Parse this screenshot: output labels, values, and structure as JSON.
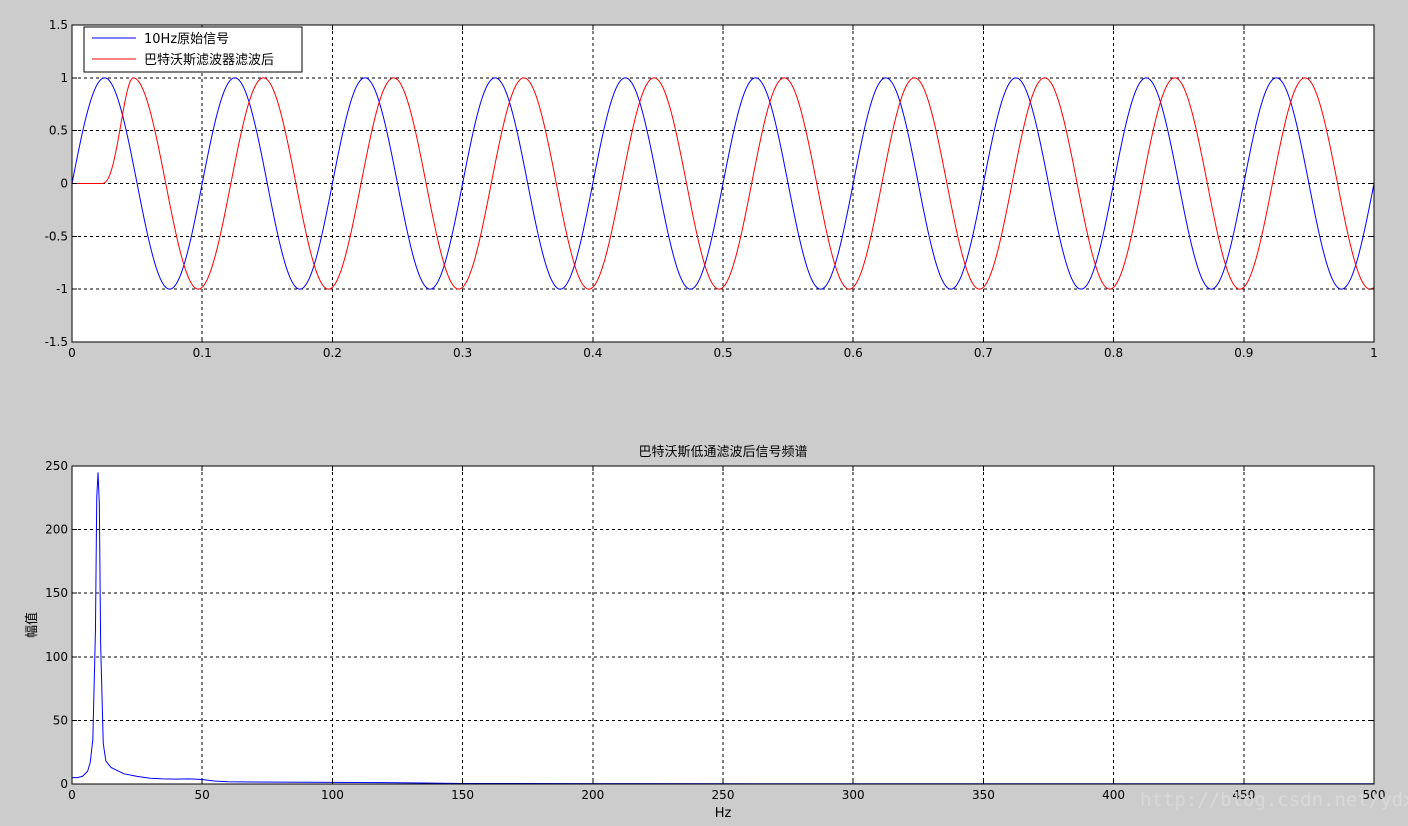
{
  "chart_data": [
    {
      "type": "line",
      "title": "",
      "xlabel": "",
      "ylabel": "",
      "xlim": [
        0,
        1
      ],
      "ylim": [
        -1.5,
        1.5
      ],
      "xticks": [
        0,
        0.1,
        0.2,
        0.3,
        0.4,
        0.5,
        0.6,
        0.7,
        0.8,
        0.9,
        1
      ],
      "xtick_labels": [
        "0",
        "0.1",
        "0.2",
        "0.3",
        "0.4",
        "0.5",
        "0.6",
        "0.7",
        "0.8",
        "0.9",
        "1"
      ],
      "yticks": [
        -1.5,
        -1,
        -0.5,
        0,
        0.5,
        1,
        1.5
      ],
      "ytick_labels": [
        "-1.5",
        "-1",
        "-0.5",
        "0",
        "0.5",
        "1",
        "1.5"
      ],
      "grid": true,
      "legend": "top-left",
      "series": [
        {
          "name": "10Hz原始信号",
          "color": "#0000ff",
          "function": "sine",
          "frequency_hz": 10,
          "amplitude": 1,
          "delay_s": 0,
          "x_range": [
            0,
            1
          ]
        },
        {
          "name": "巴特沃斯滤波器滤波后",
          "color": "#ff0000",
          "function": "sine",
          "frequency_hz": 10,
          "amplitude": 1,
          "delay_s": 0.022,
          "x_range": [
            0,
            1
          ]
        }
      ]
    },
    {
      "type": "line",
      "title": "巴特沃斯低通滤波后信号频谱",
      "xlabel": "Hz",
      "ylabel": "幅值",
      "xlim": [
        0,
        500
      ],
      "ylim": [
        0,
        250
      ],
      "xticks": [
        0,
        50,
        100,
        150,
        200,
        250,
        300,
        350,
        400,
        450,
        500
      ],
      "xtick_labels": [
        "0",
        "50",
        "100",
        "150",
        "200",
        "250",
        "300",
        "350",
        "400",
        "450",
        "500"
      ],
      "yticks": [
        0,
        50,
        100,
        150,
        200,
        250
      ],
      "ytick_labels": [
        "0",
        "50",
        "100",
        "150",
        "200",
        "250"
      ],
      "grid": true,
      "series": [
        {
          "color": "#0000ff",
          "x": [
            0,
            2,
            4,
            6,
            7,
            8,
            9,
            9.5,
            10,
            10.5,
            11,
            12,
            13,
            15,
            18,
            20,
            25,
            30,
            35,
            40,
            45,
            50,
            55,
            60,
            70,
            80,
            100,
            120,
            135,
            150,
            200,
            300,
            400,
            500
          ],
          "y": [
            5,
            5,
            6,
            10,
            17,
            35,
            120,
            225,
            245,
            220,
            110,
            32,
            18,
            13,
            10,
            8,
            6,
            4.5,
            4,
            3.8,
            4,
            3.5,
            2.3,
            1.8,
            1.6,
            1.5,
            1.3,
            1.1,
            0.8,
            0.4,
            0.3,
            0.2,
            0.2,
            0.2
          ]
        }
      ]
    }
  ],
  "watermark": "http://blog.csdn.net/ydx"
}
